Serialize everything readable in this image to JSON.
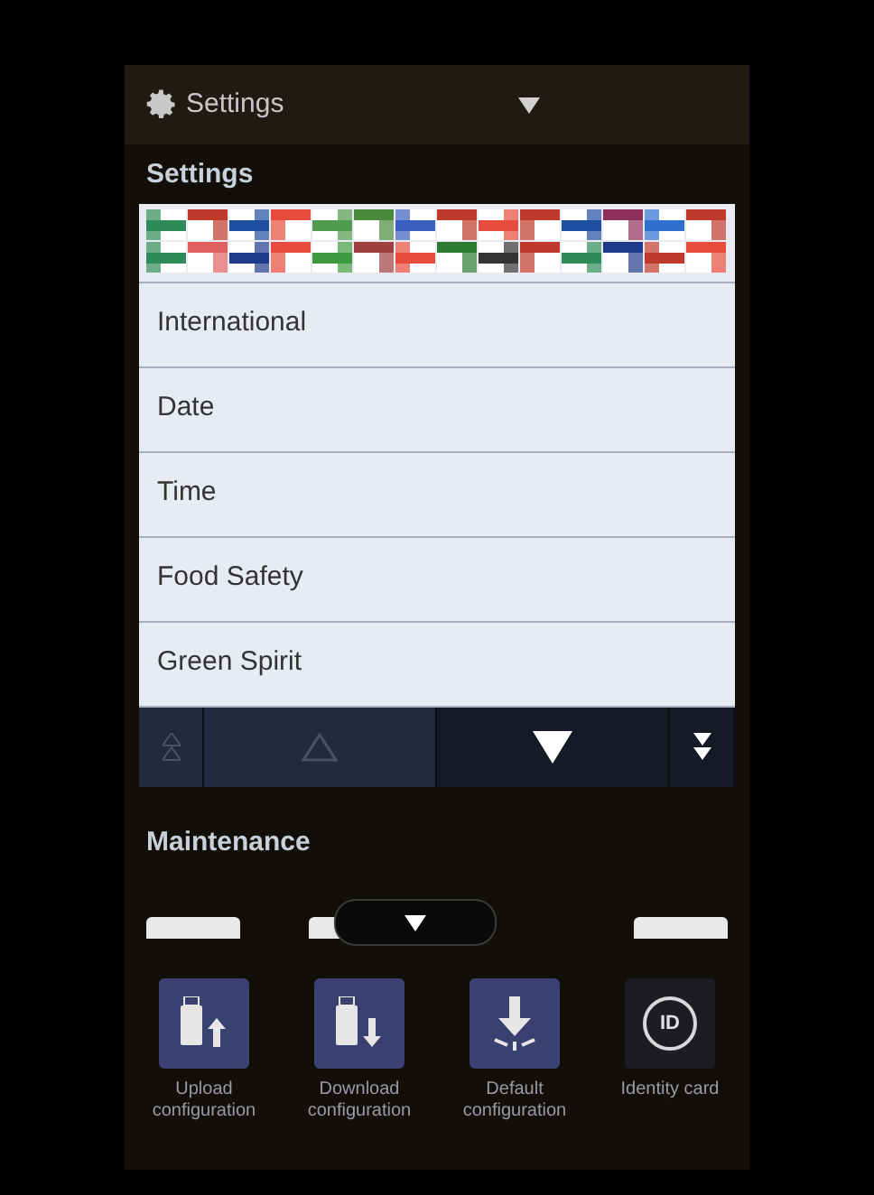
{
  "header": {
    "title": "Settings"
  },
  "settings": {
    "heading": "Settings",
    "items": [
      {
        "label": "International"
      },
      {
        "label": "Date"
      },
      {
        "label": "Time"
      },
      {
        "label": "Food Safety"
      },
      {
        "label": "Green Spirit"
      }
    ],
    "pager": [
      {
        "kind": "first",
        "disabled": true
      },
      {
        "kind": "prev",
        "disabled": true
      },
      {
        "kind": "next",
        "disabled": false
      },
      {
        "kind": "last",
        "disabled": false
      }
    ]
  },
  "maintenance": {
    "heading": "Maintenance",
    "tiles": [
      {
        "kind": "upload",
        "label": "Upload configuration"
      },
      {
        "kind": "download",
        "label": "Download configuration"
      },
      {
        "kind": "default",
        "label": "Default configuration"
      },
      {
        "kind": "identity",
        "label": "Identity card",
        "badge": "ID"
      }
    ]
  }
}
